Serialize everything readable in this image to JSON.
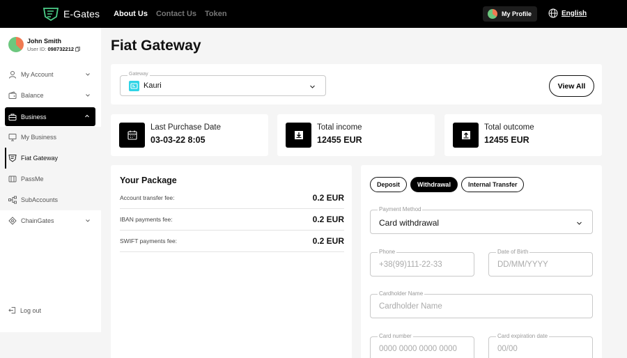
{
  "app": {
    "name": "E-Gates"
  },
  "topnav": {
    "items": [
      "About Us",
      "Contact Us",
      "Token"
    ]
  },
  "header": {
    "profile_label": "My Profile",
    "language": "English"
  },
  "user": {
    "name": "John Smith",
    "id_label": "User ID:",
    "id": "098732212"
  },
  "sidebar": {
    "my_account": "My Account",
    "balance": "Balance",
    "business": "Business",
    "sub": [
      "My Business",
      "Fiat Gateway",
      "PassMe",
      "SubAccounts"
    ],
    "chaingates": "ChainGates",
    "logout": "Log out"
  },
  "page": {
    "title": "Fiat Gateway"
  },
  "gateway": {
    "label": "Gateway",
    "value": "Kauri",
    "view_all": "View All"
  },
  "stats": [
    {
      "label": "Last Purchase Date",
      "value": "03-03-22 8:05"
    },
    {
      "label": "Total income",
      "value": "12455 EUR"
    },
    {
      "label": "Total outcome",
      "value": "12455 EUR"
    }
  ],
  "package": {
    "title": "Your Package",
    "fees": [
      {
        "name": "Account transfer fee:",
        "value": "0.2 EUR"
      },
      {
        "name": "IBAN payments fee:",
        "value": "0.2 EUR"
      },
      {
        "name": "SWIFT payments fee:",
        "value": "0.2 EUR"
      }
    ]
  },
  "form": {
    "tabs": [
      "Deposit",
      "Withdrawal",
      "Internal Transfer"
    ],
    "payment_method": {
      "label": "Payment Method",
      "value": "Card withdrawal"
    },
    "phone": {
      "label": "Phone",
      "placeholder": "+38(99)111-22-33"
    },
    "dob": {
      "label": "Date of Birth",
      "placeholder": "DD/MM/YYYY"
    },
    "cardholder": {
      "label": "Cardholder Name",
      "placeholder": "Cardholder Name"
    },
    "card_number": {
      "label": "Card number",
      "placeholder": "0000 0000 0000 0000"
    },
    "card_exp": {
      "label": "Card expiration date",
      "placeholder": "00/00"
    }
  },
  "colors": {
    "accent": "#000000",
    "gateway_icon": "#30d4e6",
    "background": "#f5f5f5"
  }
}
